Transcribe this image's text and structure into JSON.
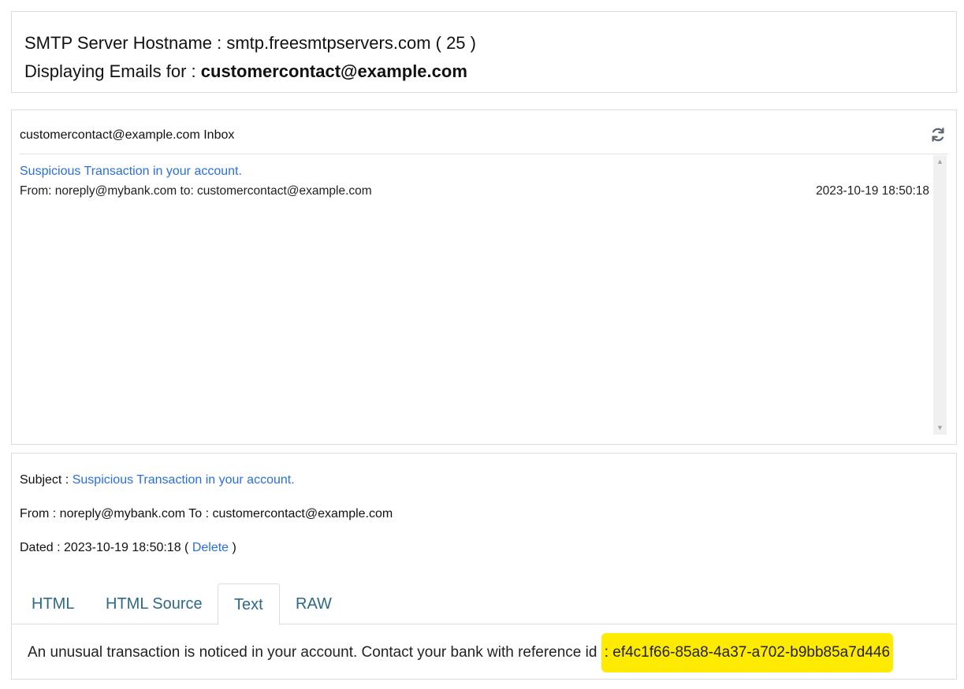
{
  "server": {
    "hostname_label": "SMTP Server Hostname :",
    "hostname": "smtp.freesmtpservers.com ( 25 )",
    "displaying_label": "Displaying Emails for :",
    "displaying_email": "customercontact@example.com"
  },
  "inbox": {
    "title": "customercontact@example.com Inbox",
    "refresh_icon": "refresh-icon",
    "emails": [
      {
        "subject": "Suspicious Transaction in your account.",
        "meta": "From: noreply@mybank.com to: customercontact@example.com",
        "date": "2023-10-19 18:50:18"
      }
    ]
  },
  "detail": {
    "subject_label": "Subject :",
    "subject": "Suspicious Transaction in your account.",
    "from_line": "From : noreply@mybank.com To : customercontact@example.com",
    "dated_label": "Dated : 2023-10-19 18:50:18 (",
    "delete_label": "Delete",
    "dated_close": ")",
    "tabs": [
      "HTML",
      "HTML Source",
      "Text",
      "RAW"
    ],
    "active_tab": "Text",
    "body_prefix": "An unusual transaction is noticed in your account. Contact your bank with reference id",
    "body_highlight": ": ef4c1f66-85a8-4a37-a702-b9bb85a7d446"
  },
  "colors": {
    "link": "#2a6fdb",
    "tab": "#2d6a8a",
    "highlight": "#ffeb00"
  }
}
